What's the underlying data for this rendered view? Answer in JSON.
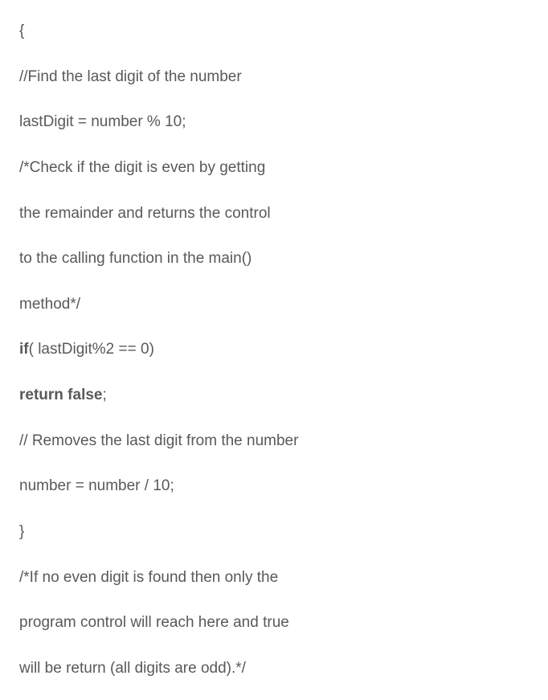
{
  "lines": [
    {
      "text": "{",
      "bold": false
    },
    {
      "text": "//Find the last digit of the number",
      "bold": false
    },
    {
      "text": "lastDigit = number % 10;",
      "bold": false
    },
    {
      "text": "/*Check if the digit is even by getting",
      "bold": false
    },
    {
      "text": "the remainder and returns the control",
      "bold": false
    },
    {
      "text": "to the calling function in the main()",
      "bold": false
    },
    {
      "text": "method*/",
      "bold": false
    },
    {
      "text": "if",
      "bold": true,
      "suffix": "( lastDigit%2 == 0)"
    },
    {
      "text": "return false",
      "bold": true,
      "suffix": ";"
    },
    {
      "text": "// Removes the last digit from the number",
      "bold": false
    },
    {
      "text": "number = number / 10;",
      "bold": false
    },
    {
      "text": "}",
      "bold": false
    },
    {
      "text": "/*If no even digit is found then only the",
      "bold": false
    },
    {
      "text": "program control will reach here and true",
      "bold": false
    },
    {
      "text": "will be return (all digits are odd).*/",
      "bold": false
    }
  ]
}
